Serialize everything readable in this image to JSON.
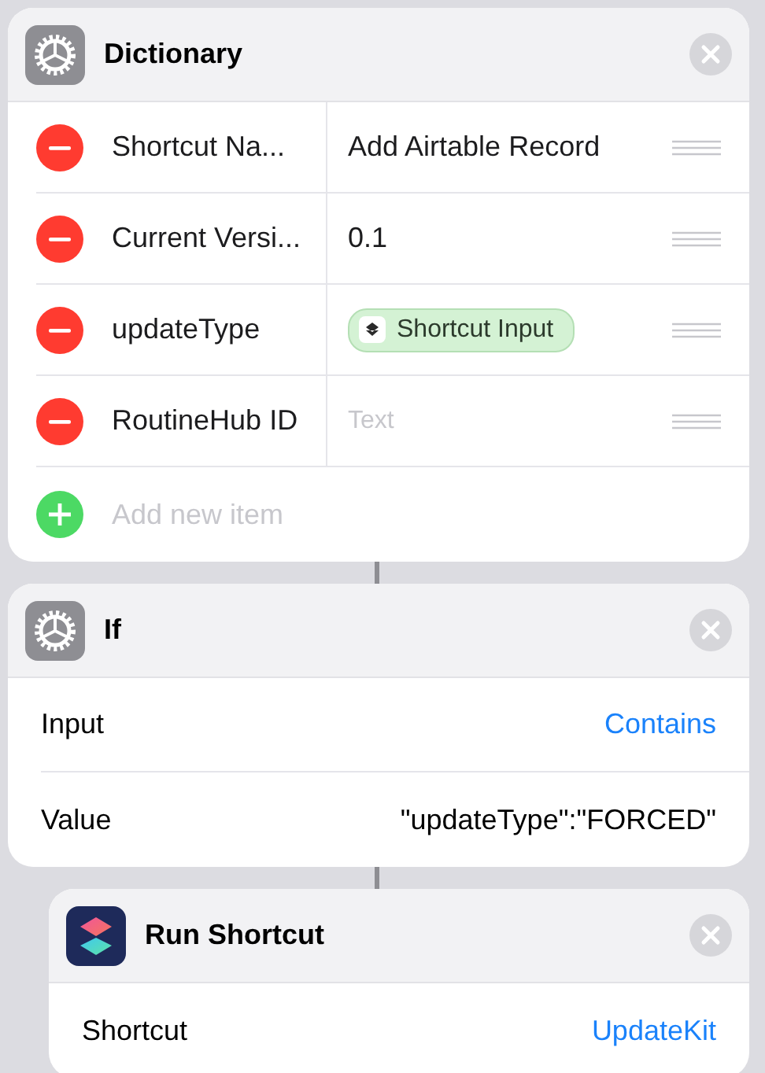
{
  "actions": [
    {
      "kind": "dictionary",
      "title": "Dictionary",
      "items": [
        {
          "key": "Shortcut Na...",
          "value": {
            "kind": "text",
            "text": "Add Airtable Record"
          }
        },
        {
          "key": "Current Versi...",
          "value": {
            "kind": "text",
            "text": "0.1"
          }
        },
        {
          "key": "updateType",
          "value": {
            "kind": "variable",
            "text": "Shortcut Input"
          }
        },
        {
          "key": "RoutineHub ID",
          "value": {
            "kind": "placeholder",
            "text": "Text"
          }
        }
      ],
      "add_label": "Add new item"
    },
    {
      "kind": "condition",
      "title": "If",
      "params": [
        {
          "label": "Input",
          "value": {
            "kind": "link",
            "text": "Contains"
          }
        },
        {
          "label": "Value",
          "value": {
            "kind": "text",
            "text": "\"updateType\":\"FORCED\""
          }
        }
      ]
    },
    {
      "kind": "run_shortcut",
      "title": "Run Shortcut",
      "params": [
        {
          "label": "Shortcut",
          "value": {
            "kind": "link",
            "text": "UpdateKit"
          }
        }
      ]
    }
  ]
}
